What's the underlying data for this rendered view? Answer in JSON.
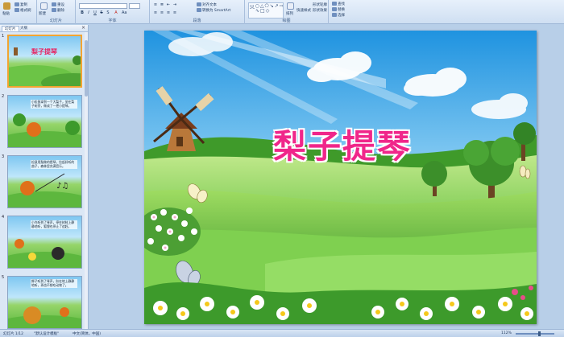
{
  "ribbon": {
    "groups": [
      {
        "id": "clipboard",
        "items": [
          "粘贴",
          "复制",
          "格式刷"
        ]
      },
      {
        "id": "slides",
        "label": "幻灯片",
        "items": [
          "新建",
          "重设",
          "删除"
        ]
      },
      {
        "id": "font",
        "label": "字体"
      },
      {
        "id": "paragraph",
        "label": "段落",
        "items": [
          "对齐文本",
          "转换为 SmartArt"
        ]
      },
      {
        "id": "drawing",
        "label": "绘图",
        "items": [
          "排列",
          "快速样式",
          "形状轮廓",
          "形状效果"
        ]
      },
      {
        "id": "editing",
        "items": [
          "查找",
          "替换",
          "选择"
        ]
      }
    ]
  },
  "left_pane": {
    "tabs": [
      "幻灯片",
      "大纲"
    ],
    "close_glyph": "×",
    "slides": [
      {
        "num": "1",
        "title": "梨子提琴",
        "text": ""
      },
      {
        "num": "2",
        "title": "",
        "text": "小松鼠拿到一个大梨子，坐在梨子树旁，做成了一把小提琴。"
      },
      {
        "num": "3",
        "title": "",
        "text": "松鼠用梨做的提琴，拉起好听的曲子，森林里充满音乐。"
      },
      {
        "num": "4",
        "title": "",
        "text": "小鸟听到了琴声，停在树枝上静静地听，狐狸也停止了追赶。"
      },
      {
        "num": "5",
        "title": "",
        "text": "狮子听到了琴声，趴在地上静静地听，再也不想吃动物了。"
      }
    ]
  },
  "slide": {
    "title": "梨子提琴"
  },
  "status_bar": {
    "slide_info": "幻灯片 1/12",
    "theme": "\"默认设计模板\"",
    "language": "中文(简体，中国)",
    "zoom": "112%"
  },
  "colors": {
    "title_pink": "#f0268a",
    "ribbon_bg": "#cfdff2",
    "workspace_bg": "#b8cfe8",
    "thumb_selected": "#f3a431"
  }
}
